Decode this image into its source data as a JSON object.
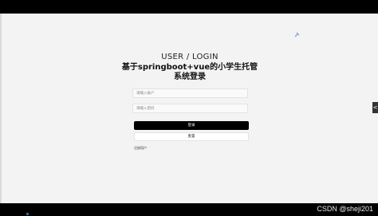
{
  "header": {
    "subtitle": "USER / LOGIN",
    "title": "基于springboot+vue的小学生托管系统登录"
  },
  "form": {
    "username_placeholder": "请输入账户",
    "password_placeholder": "请输入密码",
    "login_label": "登录",
    "reset_label": "重置",
    "register_label": "注册用户"
  },
  "side_tab_label": "<",
  "watermark": "CSDN @sheji201",
  "icons": {
    "corner": "pin-icon"
  }
}
